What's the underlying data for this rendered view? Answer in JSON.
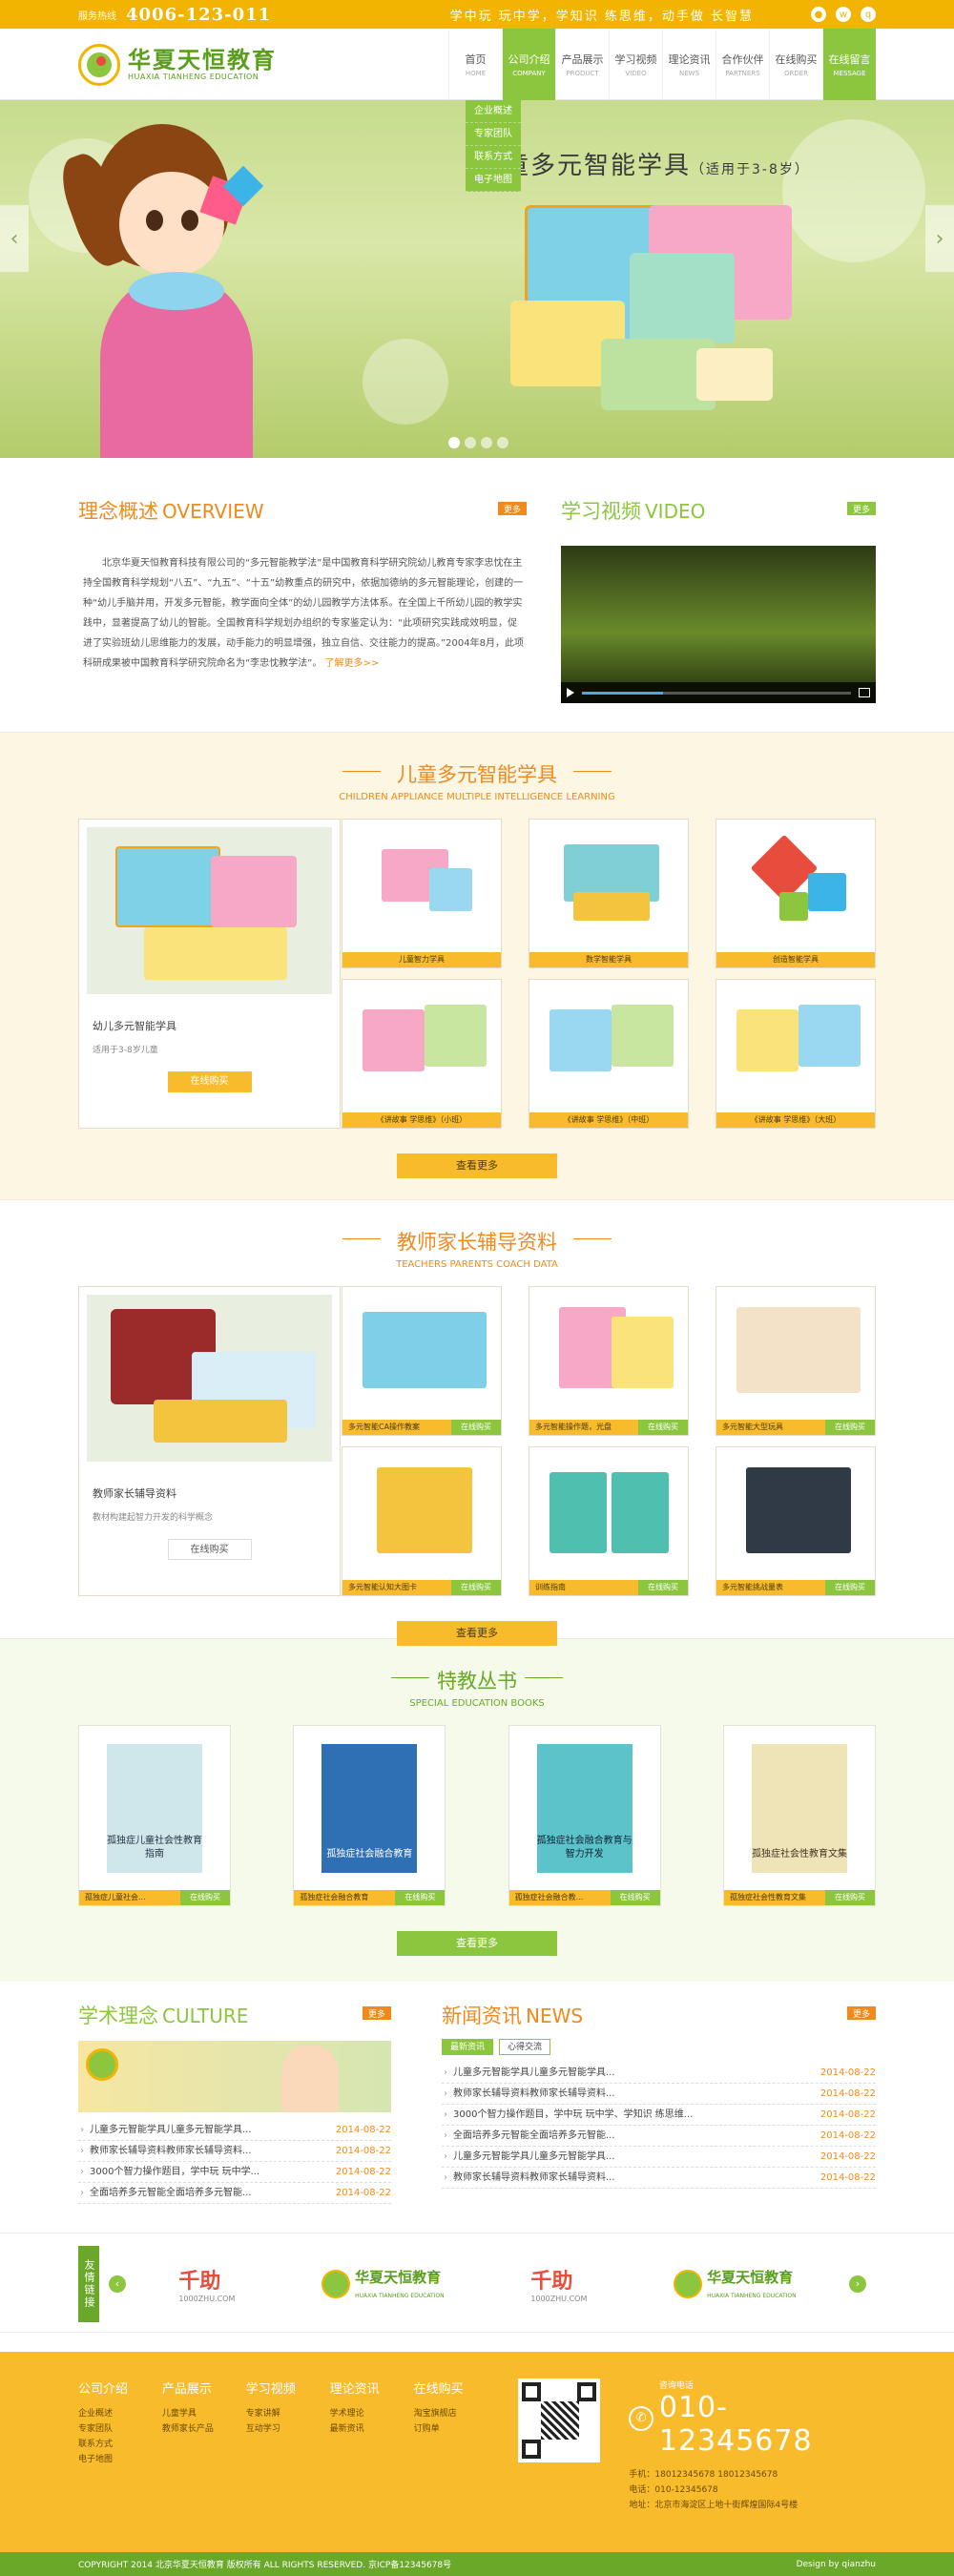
{
  "topbar": {
    "hotline_label": "服务热线",
    "hotline": "4006-123-011",
    "slogan": "学中玩 玩中学，学知识 练思维，动手做 长智慧"
  },
  "logo": {
    "cn": "华夏天恒教育",
    "en": "HUAXIA TIANHENG EDUCATION"
  },
  "nav": [
    {
      "cn": "首页",
      "en": "HOME"
    },
    {
      "cn": "公司介绍",
      "en": "COMPANY"
    },
    {
      "cn": "产品展示",
      "en": "PRODUCT"
    },
    {
      "cn": "学习视频",
      "en": "VIDEO"
    },
    {
      "cn": "理论资讯",
      "en": "NEWS"
    },
    {
      "cn": "合作伙伴",
      "en": "PARTNERS"
    },
    {
      "cn": "在线购买",
      "en": "ORDER"
    },
    {
      "cn": "在线留言",
      "en": "MESSAGE"
    }
  ],
  "dropdown": [
    "企业概述",
    "专家团队",
    "联系方式",
    "电子地图"
  ],
  "banner": {
    "title": "儿童多元智能学具",
    "sub": "（适用于3-8岁）"
  },
  "overview": {
    "cn": "理念概述",
    "en": "OVERVIEW",
    "more": "更多",
    "text": "北京华夏天恒教育科技有限公司的“多元智能教学法”是中国教育科学研究院幼儿教育专家李忠忱在主持全国教育科学规划“八五”、“九五”、“十五”幼教重点的研究中，依据加德纳的多元智能理论，创建的一种“幼儿手脑并用，开发多元智能，教学面向全体”的幼儿园教学方法体系。在全国上千所幼儿园的教学实践中，显著提高了幼儿的智能。全国教育科学规划办组织的专家鉴定认为：“此项研究实践成效明显，促进了实验班幼儿思维能力的发展，动手能力的明显增强，独立自信、交往能力的提高。”2004年8月，此项科研成果被中国教育科学研究院命名为“李忠忱教学法”。",
    "readmore": "了解更多>>"
  },
  "video": {
    "cn": "学习视频",
    "en": "VIDEO",
    "more": "更多"
  },
  "kids": {
    "cn": "儿童多元智能学具",
    "en": "CHILDREN APPLIANCE MULTIPLE INTELLIGENCE LEARNING",
    "feat_name": "幼儿多元智能学具",
    "feat_sub": "适用于3-8岁儿童",
    "feat_btn": "在线购买",
    "items": [
      "儿童智力学具",
      "数学智能学具",
      "创造智能学具",
      "《讲故事 学思维》（小班）",
      "《讲故事 学思维》（中班）",
      "《讲故事 学思维》（大班）"
    ],
    "seemore": "查看更多"
  },
  "teach": {
    "cn": "教师家长辅导资料",
    "en": "TEACHERS PARENTS COACH DATA",
    "feat_name": "教师家长辅导资料",
    "feat_sub": "教材构建起智力开发的科学概念",
    "feat_btn": "在线购买",
    "items": [
      "多元智能CA操作教案",
      "多元智能操作题，光盘",
      "多元智能大型玩具",
      "多元智能认知大图卡",
      "训练指南",
      "多元智能挑战量表"
    ],
    "buy": "在线购买",
    "seemore": "查看更多"
  },
  "books": {
    "cn": "特教丛书",
    "en": "SPECIAL EDUCATION BOOKS",
    "items": [
      {
        "name": "孤独症儿童社会...",
        "cover": "孤独症儿童社会性教育指南"
      },
      {
        "name": "孤独症社会融合教育",
        "cover": "孤独症社会融合教育"
      },
      {
        "name": "孤独症社会融合教...",
        "cover": "孤独症社会融合教育与智力开发"
      },
      {
        "name": "孤独症社会性教育文集",
        "cover": "孤独症社会性教育文集"
      }
    ],
    "buy": "在线购买",
    "seemore": "查看更多"
  },
  "culture": {
    "cn": "学术理念",
    "en": "CULTURE",
    "more": "更多",
    "list": [
      {
        "t": "儿童多元智能学具儿童多元智能学具...",
        "d": "2014-08-22"
      },
      {
        "t": "教师家长辅导资料教师家长辅导资料...",
        "d": "2014-08-22"
      },
      {
        "t": "3000个智力操作题目，学中玩 玩中学...",
        "d": "2014-08-22"
      },
      {
        "t": "全面培养多元智能全面培养多元智能...",
        "d": "2014-08-22"
      }
    ]
  },
  "news": {
    "cn": "新闻资讯",
    "en": "NEWS",
    "more": "更多",
    "tabs": [
      "最新资讯",
      "心得交流"
    ],
    "list": [
      {
        "t": "儿童多元智能学具儿童多元智能学具...",
        "d": "2014-08-22"
      },
      {
        "t": "教师家长辅导资料教师家长辅导资料...",
        "d": "2014-08-22"
      },
      {
        "t": "3000个智力操作题目，学中玩 玩中学、学知识 练思维...",
        "d": "2014-08-22"
      },
      {
        "t": "全面培养多元智能全面培养多元智能...",
        "d": "2014-08-22"
      },
      {
        "t": "儿童多元智能学具儿童多元智能学具...",
        "d": "2014-08-22"
      },
      {
        "t": "教师家长辅导资料教师家长辅导资料...",
        "d": "2014-08-22"
      }
    ]
  },
  "links": {
    "tag": "友情链接",
    "q1": "千助",
    "q1url": "1000ZHU.COM",
    "h": "华夏天恒教育",
    "hen": "HUAXIA TIANHENG EDUCATION"
  },
  "footer": {
    "cols": [
      {
        "h": "公司介绍",
        "items": [
          "企业概述",
          "专家团队",
          "联系方式",
          "电子地图"
        ]
      },
      {
        "h": "产品展示",
        "items": [
          "儿童学具",
          "教师家长产品"
        ]
      },
      {
        "h": "学习视频",
        "items": [
          "专家讲解",
          "互动学习"
        ]
      },
      {
        "h": "理论资讯",
        "items": [
          "学术理论",
          "最新资讯"
        ]
      },
      {
        "h": "在线购买",
        "items": [
          "淘宝旗舰店",
          "订购单"
        ]
      }
    ],
    "tel_label": "咨询电话",
    "tel": "010-12345678",
    "info": [
      "手机：18012345678 18012345678",
      "电话：010-12345678",
      "地址：北京市海淀区上地十街辉煌国际4号楼"
    ]
  },
  "copyright": {
    "text": "COPYRIGHT 2014  北京华夏天恒教育 版权所有 ALL RIGHTS RESERVED.  京ICP备12345678号",
    "design": "Design by qianzhu"
  },
  "colors": {
    "orange": "#f08a1c",
    "yellow": "#f8bb2b",
    "green": "#8cc63f"
  }
}
